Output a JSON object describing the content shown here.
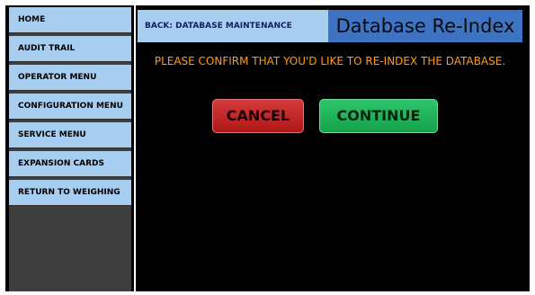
{
  "sidebar": {
    "items": [
      {
        "label": "HOME"
      },
      {
        "label": "AUDIT TRAIL"
      },
      {
        "label": "OPERATOR MENU"
      },
      {
        "label": "CONFIGURATION MENU"
      },
      {
        "label": "SERVICE MENU"
      },
      {
        "label": "EXPANSION CARDS"
      },
      {
        "label": "RETURN TO WEIGHING"
      }
    ]
  },
  "header": {
    "back_label": "BACK: DATABASE MAINTENANCE",
    "title": "Database Re-Index"
  },
  "main": {
    "message": "PLEASE CONFIRM THAT YOU'D LIKE TO RE-INDEX THE DATABASE.",
    "cancel_label": "CANCEL",
    "continue_label": "CONTINUE"
  },
  "colors": {
    "sidebar_item": "#a7cef0",
    "title_bar": "#3d73c3",
    "message_text": "#ff9c1a",
    "cancel": "#c02222",
    "continue": "#1bb055",
    "background": "#000000"
  }
}
